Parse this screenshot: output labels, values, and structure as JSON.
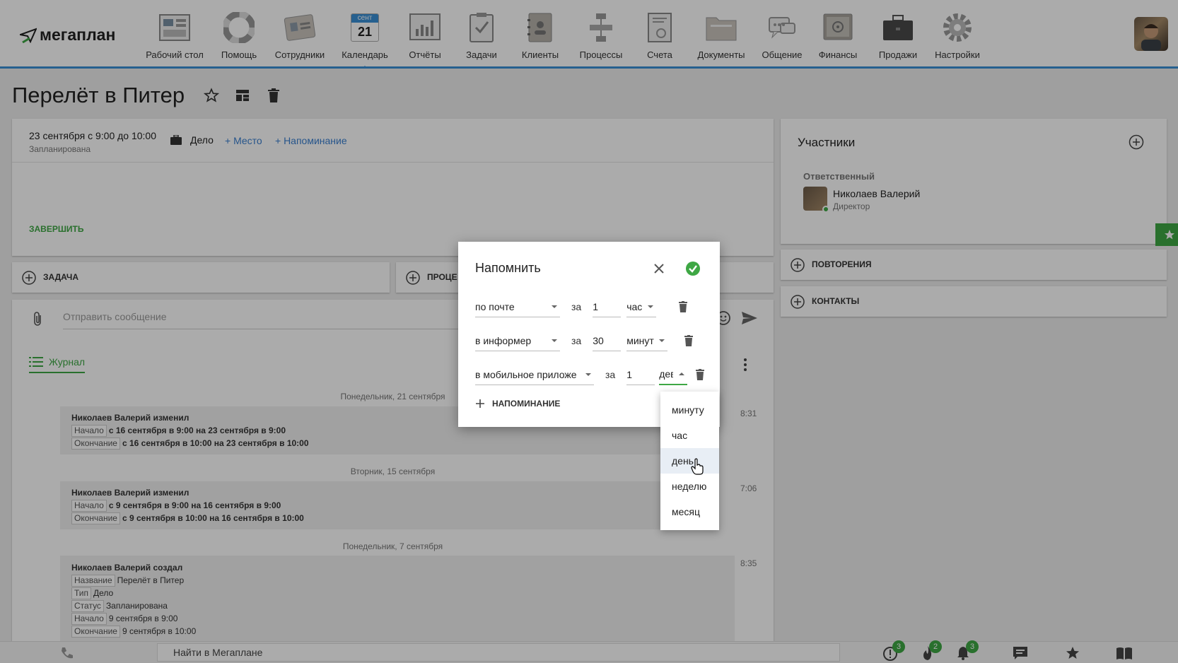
{
  "app": {
    "logo_text": "мегаплан"
  },
  "nav": [
    {
      "label": "Рабочий стол",
      "icon": "dashboard-icon"
    },
    {
      "label": "Помощь",
      "icon": "lifebuoy-icon"
    },
    {
      "label": "Сотрудники",
      "icon": "employees-icon"
    },
    {
      "label": "Календарь",
      "icon": "calendar-icon",
      "month": "сент",
      "day": "21",
      "active": true
    },
    {
      "label": "Отчёты",
      "icon": "reports-icon"
    },
    {
      "label": "Задачи",
      "icon": "tasks-icon"
    },
    {
      "label": "Клиенты",
      "icon": "clients-icon"
    },
    {
      "label": "Процессы",
      "icon": "processes-icon"
    },
    {
      "label": "Счета",
      "icon": "invoices-icon"
    },
    {
      "label": "Документы",
      "icon": "documents-icon"
    },
    {
      "label": "Общение",
      "icon": "chat-icon"
    },
    {
      "label": "Финансы",
      "icon": "safe-icon"
    },
    {
      "label": "Продажи",
      "icon": "briefcase-icon"
    },
    {
      "label": "Настройки",
      "icon": "gear-icon"
    }
  ],
  "page": {
    "title": "Перелёт в Питер"
  },
  "event": {
    "datetime": "23 сентября с 9:00 до 10:00",
    "status": "Запланирована",
    "type": "Дело",
    "add_place": "+ Место",
    "add_reminder": "+ Напоминание",
    "finish": "ЗАВЕРШИТЬ"
  },
  "actions": {
    "task": "ЗАДАЧА",
    "process": "ПРОЦЕ"
  },
  "message": {
    "placeholder": "Отправить сообщение"
  },
  "journal": {
    "tab": "Журнал",
    "groups": [
      {
        "date": "Понедельник, 21 сентября",
        "time": "8:31",
        "author": "Николаев Валерий изменил",
        "lines": [
          {
            "tag": "Начало",
            "text": "с 16 сентября в 9:00 на 23 сентября в 9:00"
          },
          {
            "tag": "Окончание",
            "text": "с 16 сентября в 10:00 на 23 сентября в 10:00"
          }
        ]
      },
      {
        "date": "Вторник, 15 сентября",
        "time": "7:06",
        "author": "Николаев Валерий изменил",
        "lines": [
          {
            "tag": "Начало",
            "text": "с 9 сентября в 9:00 на 16 сентября в 9:00"
          },
          {
            "tag": "Окончание",
            "text": "с 9 сентября в 10:00 на 16 сентября в 10:00"
          }
        ]
      },
      {
        "date": "Понедельник, 7 сентября",
        "time": "8:35",
        "author": "Николаев Валерий создал",
        "lines": [
          {
            "tag": "Название",
            "text": "Перелёт в Питер"
          },
          {
            "tag": "Тип",
            "text": "Дело"
          },
          {
            "tag": "Статус",
            "text": "Запланирована"
          },
          {
            "tag": "Начало",
            "text": "9 сентября в 9:00"
          },
          {
            "tag": "Окончание",
            "text": "9 сентября в 10:00"
          }
        ]
      }
    ]
  },
  "participants": {
    "title": "Участники",
    "role": "Ответственный",
    "name": "Николаев Валерий",
    "position": "Директор"
  },
  "sections": {
    "repeats": "ПОВТОРЕНИЯ",
    "contacts": "КОНТАКТЫ"
  },
  "modal": {
    "title": "Напомнить",
    "rows": [
      {
        "channel": "по почте",
        "za": "за",
        "amount": "1",
        "unit": "час"
      },
      {
        "channel": "в информер",
        "za": "за",
        "amount": "30",
        "unit": "минут"
      },
      {
        "channel": "в мобильное приложе",
        "za": "за",
        "amount": "1",
        "unit": "дев"
      }
    ],
    "add": "НАПОМИНАНИЕ"
  },
  "unit_options": [
    "минуту",
    "час",
    "день",
    "неделю",
    "месяц"
  ],
  "bottom": {
    "search": "Найти в Мегаплане",
    "badges": [
      "3",
      "2",
      "3"
    ]
  },
  "colors": {
    "accent": "#3a8fd6",
    "green": "#3ea744",
    "link": "#3a7fd0"
  }
}
